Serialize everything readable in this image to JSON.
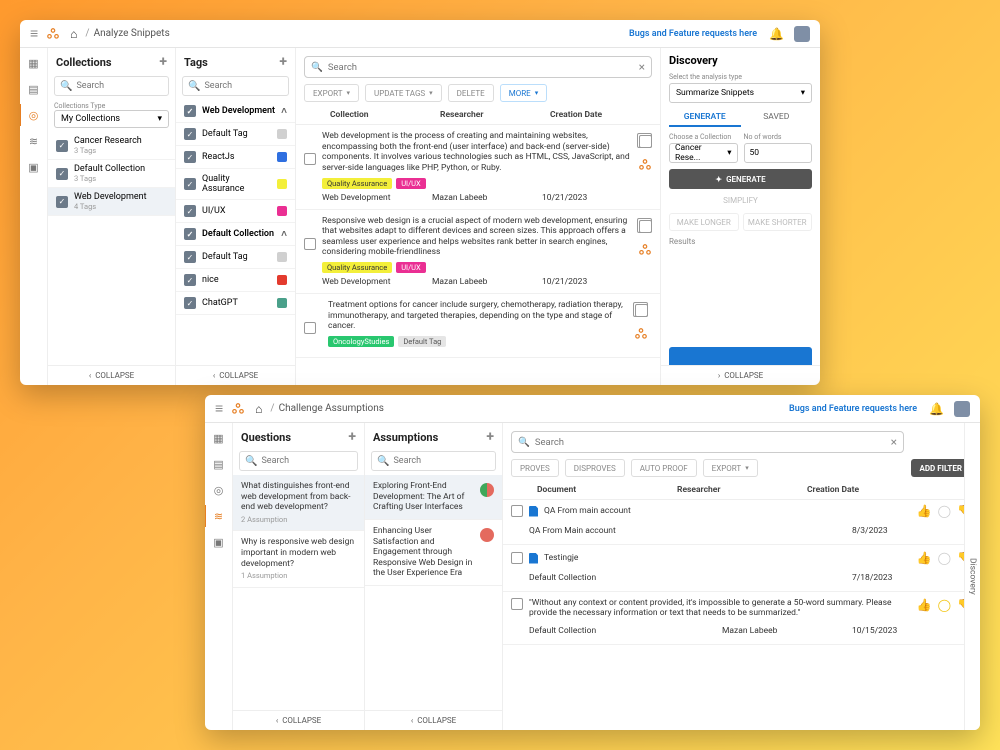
{
  "common": {
    "feedback_link": "Bugs and Feature requests here",
    "search_placeholder": "Search",
    "collapse_label": "COLLAPSE"
  },
  "win1": {
    "breadcrumb": "Analyze Snippets",
    "collections": {
      "title": "Collections",
      "type_label": "Collections Type",
      "type_value": "My Collections",
      "items": [
        {
          "name": "Cancer Research",
          "sub": "3 Tags"
        },
        {
          "name": "Default Collection",
          "sub": "3 Tags"
        },
        {
          "name": "Web Development",
          "sub": "4 Tags"
        }
      ]
    },
    "tags": {
      "title": "Tags",
      "groups": [
        {
          "name": "Web Development",
          "expanded": true,
          "tags": [
            {
              "name": "Default Tag",
              "color": "#d0d0d0"
            },
            {
              "name": "ReactJs",
              "color": "#2f6fe0"
            },
            {
              "name": "Quality Assurance",
              "color": "#f3ef3a"
            },
            {
              "name": "UI/UX",
              "color": "#ea2f93"
            }
          ]
        },
        {
          "name": "Default Collection",
          "expanded": true,
          "tags": [
            {
              "name": "Default Tag",
              "color": "#d0d0d0"
            },
            {
              "name": "nice",
              "color": "#e33b2e"
            },
            {
              "name": "ChatGPT",
              "color": "#4aa08a"
            }
          ]
        }
      ]
    },
    "table": {
      "headers": {
        "c1": "Collection",
        "c2": "Researcher",
        "c3": "Creation Date"
      },
      "toolbar": {
        "export": "EXPORT",
        "update_tags": "UPDATE TAGS",
        "delete": "DELETE",
        "more": "MORE"
      },
      "snippets": [
        {
          "text": "Web development is the process of creating and maintaining websites, encompassing both the front-end (user interface) and back-end (server-side) components. It involves various technologies such as HTML, CSS, JavaScript, and server-side languages like PHP, Python, or Ruby.",
          "tags": [
            {
              "label": "Quality Assurance",
              "bg": "#f3ef3a",
              "fg": "#333"
            },
            {
              "label": "UI/UX",
              "bg": "#ea2f93",
              "fg": "#fff"
            }
          ],
          "collection": "Web Development",
          "researcher": "Mazan Labeeb",
          "date": "10/21/2023"
        },
        {
          "text": "Responsive web design is a crucial aspect of modern web development, ensuring that websites adapt to different devices and screen sizes. This approach offers a seamless user experience and helps websites rank better in search engines, considering mobile-friendliness",
          "tags": [
            {
              "label": "Quality Assurance",
              "bg": "#f3ef3a",
              "fg": "#333"
            },
            {
              "label": "UI/UX",
              "bg": "#ea2f93",
              "fg": "#fff"
            }
          ],
          "collection": "Web Development",
          "researcher": "Mazan Labeeb",
          "date": "10/21/2023"
        },
        {
          "text": "Treatment options for cancer include surgery, chemotherapy, radiation therapy, immunotherapy, and targeted therapies, depending on the type and stage of cancer.",
          "tags": [
            {
              "label": "OncologyStudies",
              "bg": "#29c76f",
              "fg": "#fff"
            },
            {
              "label": "Default Tag",
              "bg": "#e5e5e5",
              "fg": "#555"
            }
          ],
          "collection": "",
          "researcher": "",
          "date": ""
        }
      ]
    },
    "discovery": {
      "title": "Discovery",
      "analysis_type_label": "Select the analysis type",
      "analysis_type_value": "Summarize Snippets",
      "tabs": {
        "generate": "GENERATE",
        "saved": "SAVED"
      },
      "choose_collection_label": "Choose a Collection",
      "choose_collection_value": "Cancer Rese...",
      "words_label": "No of words",
      "words_value": "50",
      "generate_btn": "GENERATE",
      "simplify": "SIMPLIFY",
      "make_longer": "MAKE LONGER",
      "make_shorter": "MAKE SHORTER",
      "results_label": "Results"
    }
  },
  "win2": {
    "breadcrumb": "Challenge Assumptions",
    "questions": {
      "title": "Questions",
      "items": [
        {
          "text": "What distinguishes front-end web development from back-end web development?",
          "sub": "2 Assumption"
        },
        {
          "text": "Why is responsive web design important in modern web development?",
          "sub": "1 Assumption"
        }
      ]
    },
    "assumptions": {
      "title": "Assumptions",
      "items": [
        {
          "text": "Exploring Front-End Development: The Art of Crafting User Interfaces",
          "color": "half"
        },
        {
          "text": "Enhancing User Satisfaction and Engagement through Responsive Web Design in the User Experience Era",
          "color": "#e46a5e"
        }
      ]
    },
    "main": {
      "toolbar": {
        "proves": "PROVES",
        "disproves": "DISPROVES",
        "auto_proof": "AUTO PROOF",
        "export": "EXPORT"
      },
      "add_filter": "ADD FILTER",
      "headers": {
        "c1": "Document",
        "c2": "Researcher",
        "c3": "Creation Date"
      },
      "rows": [
        {
          "doc": "QA From main account",
          "sub_collection": "QA From Main account",
          "researcher": "",
          "date": "8/3/2023",
          "thumbs": "up-green"
        },
        {
          "doc": "Testingje",
          "sub_collection": "Default Collection",
          "researcher": "",
          "date": "7/18/2023",
          "thumbs": "down-red"
        },
        {
          "quote": "\"Without any context or content provided, it's impossible to generate a 50-word summary. Please provide the necessary information or text that needs to be summarized.\"",
          "sub_collection": "Default Collection",
          "researcher": "Mazan Labeeb",
          "date": "10/15/2023",
          "thumbs": "mid-yellow"
        }
      ],
      "discovery_tab": "Discovery"
    }
  }
}
